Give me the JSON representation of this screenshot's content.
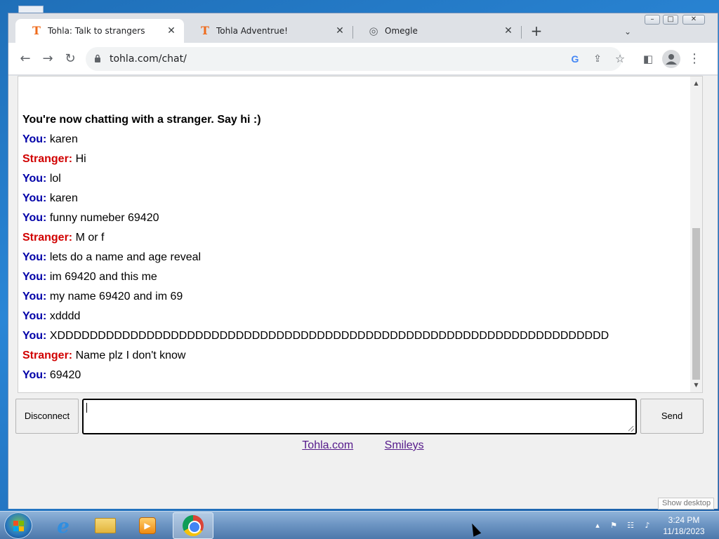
{
  "browser": {
    "tabs": [
      {
        "title": "Tohla: Talk to strangers",
        "active": true,
        "favicon": "tohla-logo-icon",
        "favicon_text": "T"
      },
      {
        "title": "Tohla Adventrue!",
        "active": false,
        "favicon": "tohla-logo-icon",
        "favicon_text": "T"
      },
      {
        "title": "Omegle",
        "active": false,
        "favicon": "globe-icon",
        "favicon_text": "◎"
      }
    ],
    "tab_close_glyph": "✕",
    "new_tab_glyph": "+",
    "tab_search_glyph": "⌄",
    "window_controls": {
      "minimize": "–",
      "maximize": "□",
      "close": "✕"
    },
    "url": "tohla.com/chat/",
    "nav": {
      "back": "←",
      "forward": "→",
      "reload": "↻"
    },
    "omnibox_icons": {
      "google": "G",
      "share": "⇪",
      "bookmark": "☆"
    },
    "toolbar_icons": {
      "side_panel": "◧",
      "profile": "●",
      "menu": "⋮"
    }
  },
  "chat": {
    "status": "You're now chatting with a stranger. Say hi :)",
    "messages": [
      {
        "sender": "You:",
        "text": "karen"
      },
      {
        "sender": "Stranger:",
        "text": "Hi"
      },
      {
        "sender": "You:",
        "text": "lol"
      },
      {
        "sender": "You:",
        "text": "karen"
      },
      {
        "sender": "You:",
        "text": "funny numeber 69420"
      },
      {
        "sender": "Stranger:",
        "text": "M or f"
      },
      {
        "sender": "You:",
        "text": "lets do a name and age reveal"
      },
      {
        "sender": "You:",
        "text": "im 69420 and this me"
      },
      {
        "sender": "You:",
        "text": "my name 69420 and im 69"
      },
      {
        "sender": "You:",
        "text": "xdddd"
      },
      {
        "sender": "You:",
        "text": "XDDDDDDDDDDDDDDDDDDDDDDDDDDDDDDDDDDDDDDDDDDDDDDDDDDDDDDDDDDDDDDDDDDDD"
      },
      {
        "sender": "Stranger:",
        "text": "Name plz I don't know"
      },
      {
        "sender": "You:",
        "text": "69420"
      }
    ],
    "colors": {
      "you": "#0000a8",
      "stranger": "#d10000"
    },
    "input_value": "",
    "disconnect_label": "Disconnect",
    "send_label": "Send",
    "scroll_up": "▲",
    "scroll_down": "▼"
  },
  "footer": {
    "links": [
      "Tohla.com",
      "Smileys"
    ]
  },
  "taskbar": {
    "apps": [
      {
        "name": "internet-explorer",
        "glyph": "e"
      },
      {
        "name": "windows-explorer",
        "glyph": ""
      },
      {
        "name": "media-player",
        "glyph": "▶"
      },
      {
        "name": "google-chrome",
        "glyph": "",
        "active": true
      }
    ],
    "tray": {
      "show_hidden": "▴",
      "action_center": "⚑",
      "network": "☷",
      "volume": "♪"
    },
    "time": "3:24 PM",
    "date": "11/18/2023",
    "show_desktop_tooltip": "Show desktop"
  }
}
